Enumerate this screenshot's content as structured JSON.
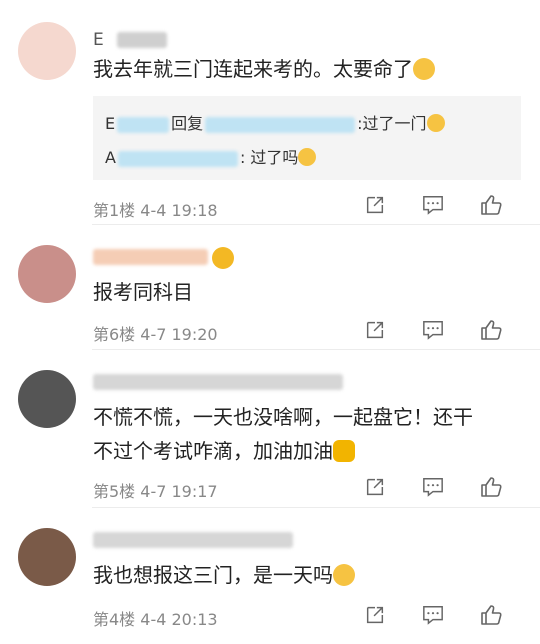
{
  "comments": [
    {
      "username_visible": "E",
      "text": "我去年就三门连起来考的。太要命了",
      "emoji": "crying-face",
      "replies": [
        {
          "prefix": "E",
          "middle": "回复",
          "suffix": ":过了一门"
        },
        {
          "prefix": "A",
          "suffix": ": 过了吗"
        }
      ],
      "floor": "第1楼",
      "date": "4-4 19:18"
    },
    {
      "text": "报考同科目",
      "floor": "第6楼",
      "date": "4-7 19:20"
    },
    {
      "text_line1": "不慌不慌，一天也没啥啊，一起盘它！还干",
      "text_line2": "不过个考试咋滴，加油加油",
      "emoji": "flexed-biceps",
      "floor": "第5楼",
      "date": "4-7 19:17"
    },
    {
      "text": "我也想报这三门，是一天吗",
      "emoji": "worried-face",
      "floor": "第4楼",
      "date": "4-4 20:13"
    }
  ],
  "colors": {
    "text": "#222222",
    "meta": "#888888",
    "reply_bg": "#f4f4f4",
    "icon": "#666666"
  }
}
